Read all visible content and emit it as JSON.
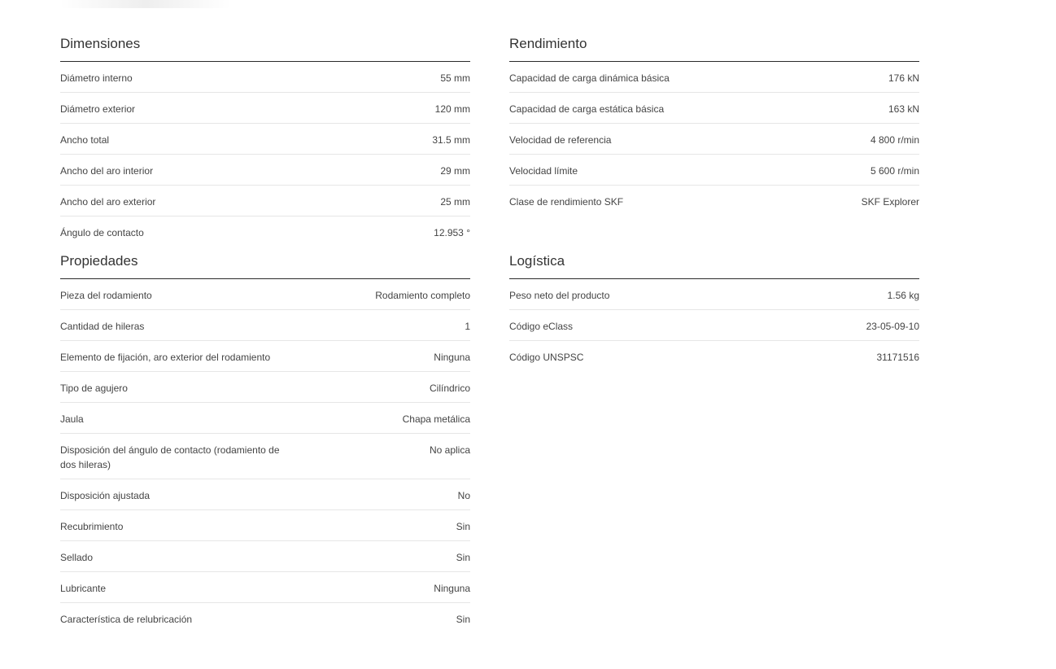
{
  "sections": {
    "dimensiones": {
      "title": "Dimensiones",
      "rows": [
        {
          "label": "Diámetro interno",
          "value": "55 mm"
        },
        {
          "label": "Diámetro exterior",
          "value": "120 mm"
        },
        {
          "label": "Ancho total",
          "value": "31.5 mm"
        },
        {
          "label": "Ancho del aro interior",
          "value": "29 mm"
        },
        {
          "label": "Ancho del aro exterior",
          "value": "25 mm"
        },
        {
          "label": "Ángulo de contacto",
          "value": "12.953 °"
        }
      ]
    },
    "rendimiento": {
      "title": "Rendimiento",
      "rows": [
        {
          "label": "Capacidad de carga dinámica básica",
          "value": "176 kN"
        },
        {
          "label": "Capacidad de carga estática básica",
          "value": "163 kN"
        },
        {
          "label": "Velocidad de referencia",
          "value": "4 800 r/min"
        },
        {
          "label": "Velocidad límite",
          "value": "5 600 r/min"
        },
        {
          "label": "Clase de rendimiento SKF",
          "value": "SKF Explorer"
        }
      ]
    },
    "propiedades": {
      "title": "Propiedades",
      "rows": [
        {
          "label": "Pieza del rodamiento",
          "value": "Rodamiento completo"
        },
        {
          "label": "Cantidad de hileras",
          "value": "1"
        },
        {
          "label": "Elemento de fijación, aro exterior del rodamiento",
          "value": "Ninguna"
        },
        {
          "label": "Tipo de agujero",
          "value": "Cilíndrico"
        },
        {
          "label": "Jaula",
          "value": "Chapa metálica"
        },
        {
          "label": "Disposición del ángulo de contacto (rodamiento de dos hileras)",
          "value": "No aplica"
        },
        {
          "label": "Disposición ajustada",
          "value": "No"
        },
        {
          "label": "Recubrimiento",
          "value": "Sin"
        },
        {
          "label": "Sellado",
          "value": "Sin"
        },
        {
          "label": "Lubricante",
          "value": "Ninguna"
        },
        {
          "label": "Característica de relubricación",
          "value": "Sin"
        }
      ]
    },
    "logistica": {
      "title": "Logística",
      "rows": [
        {
          "label": "Peso neto del producto",
          "value": "1.56 kg"
        },
        {
          "label": "Código eClass",
          "value": "23-05-09-10"
        },
        {
          "label": "Código UNSPSC",
          "value": "31171516"
        }
      ]
    }
  }
}
